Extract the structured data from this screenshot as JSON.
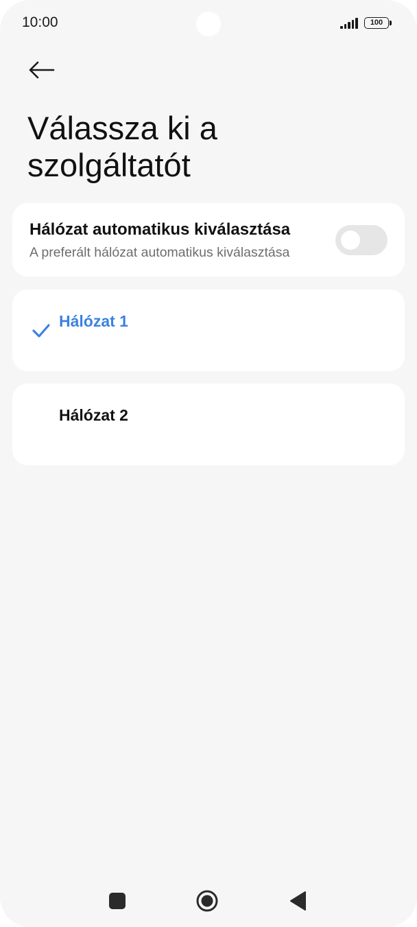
{
  "status_bar": {
    "time": "10:00",
    "battery": "100",
    "signal_icon": "signal-bars-icon",
    "battery_icon": "battery-icon"
  },
  "header": {
    "back_icon": "arrow-left-icon",
    "title": "Válassza ki a szolgáltatót"
  },
  "auto_select": {
    "title": "Hálózat automatikus kiválasztása",
    "subtitle": "A preferált hálózat automatikus kiválasztása",
    "toggle_on": false
  },
  "networks": [
    {
      "label": "Hálózat 1",
      "selected": true
    },
    {
      "label": "Hálózat 2",
      "selected": false
    }
  ],
  "nav_bar": {
    "recent_icon": "square-icon",
    "home_icon": "circle-home-icon",
    "back_icon": "triangle-back-icon"
  },
  "colors": {
    "accent": "#3b82e0",
    "background": "#f6f6f6",
    "card": "#ffffff",
    "toggle_off": "#e6e6e6"
  }
}
